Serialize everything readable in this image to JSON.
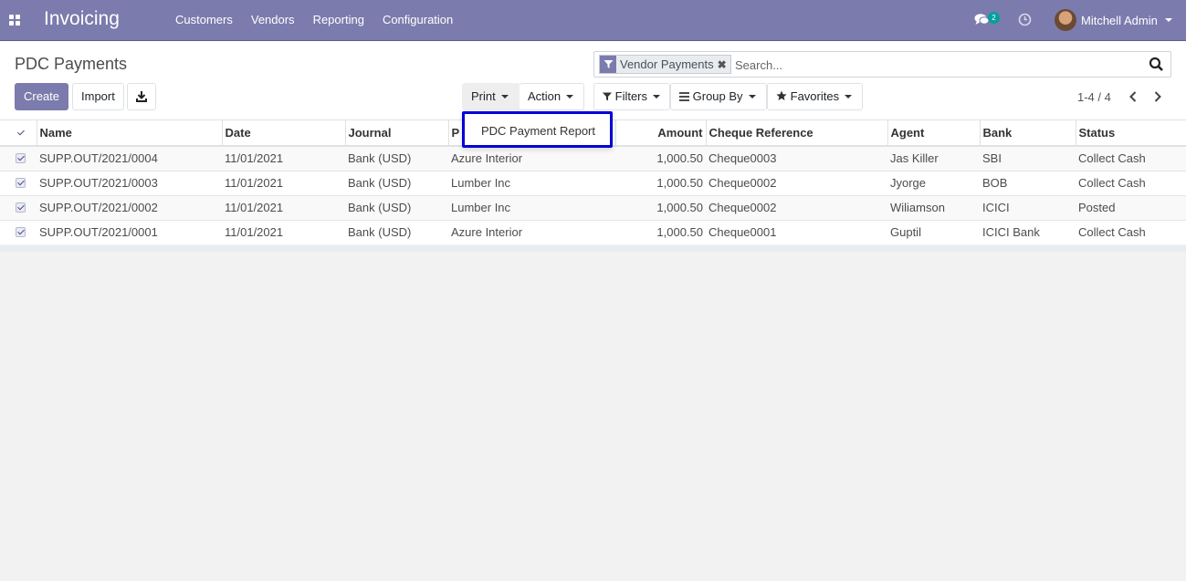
{
  "navbar": {
    "app_title": "Invoicing",
    "menu": [
      "Customers",
      "Vendors",
      "Reporting",
      "Configuration"
    ],
    "chat_count": "2",
    "user_name": "Mitchell Admin",
    "brand_color": "#7c7bad"
  },
  "control_panel": {
    "breadcrumb": "PDC Payments",
    "create_label": "Create",
    "import_label": "Import",
    "print_label": "Print",
    "action_label": "Action",
    "filters_label": "Filters",
    "groupby_label": "Group By",
    "favorites_label": "Favorites",
    "search_facet": "Vendor Payments",
    "search_placeholder": "Search...",
    "pager": "1-4 / 4"
  },
  "print_menu": {
    "items": [
      "PDC Payment Report"
    ]
  },
  "table": {
    "columns": [
      "Name",
      "Date",
      "Journal",
      "P",
      "Amount",
      "Cheque Reference",
      "Agent",
      "Bank",
      "Status"
    ],
    "rows": [
      {
        "name": "SUPP.OUT/2021/0004",
        "date": "11/01/2021",
        "journal": "Bank (USD)",
        "partner": "Azure Interior",
        "amount": "1,000.50",
        "cheque": "Cheque0003",
        "agent": "Jas Killer",
        "bank": "SBI",
        "status": "Collect Cash"
      },
      {
        "name": "SUPP.OUT/2021/0003",
        "date": "11/01/2021",
        "journal": "Bank (USD)",
        "partner": "Lumber Inc",
        "amount": "1,000.50",
        "cheque": "Cheque0002",
        "agent": "Jyorge",
        "bank": "BOB",
        "status": "Collect Cash"
      },
      {
        "name": "SUPP.OUT/2021/0002",
        "date": "11/01/2021",
        "journal": "Bank (USD)",
        "partner": "Lumber Inc",
        "amount": "1,000.50",
        "cheque": "Cheque0002",
        "agent": "Wiliamson",
        "bank": "ICICI",
        "status": "Posted"
      },
      {
        "name": "SUPP.OUT/2021/0001",
        "date": "11/01/2021",
        "journal": "Bank (USD)",
        "partner": "Azure Interior",
        "amount": "1,000.50",
        "cheque": "Cheque0001",
        "agent": "Guptil",
        "bank": "ICICI Bank",
        "status": "Collect Cash"
      }
    ]
  }
}
